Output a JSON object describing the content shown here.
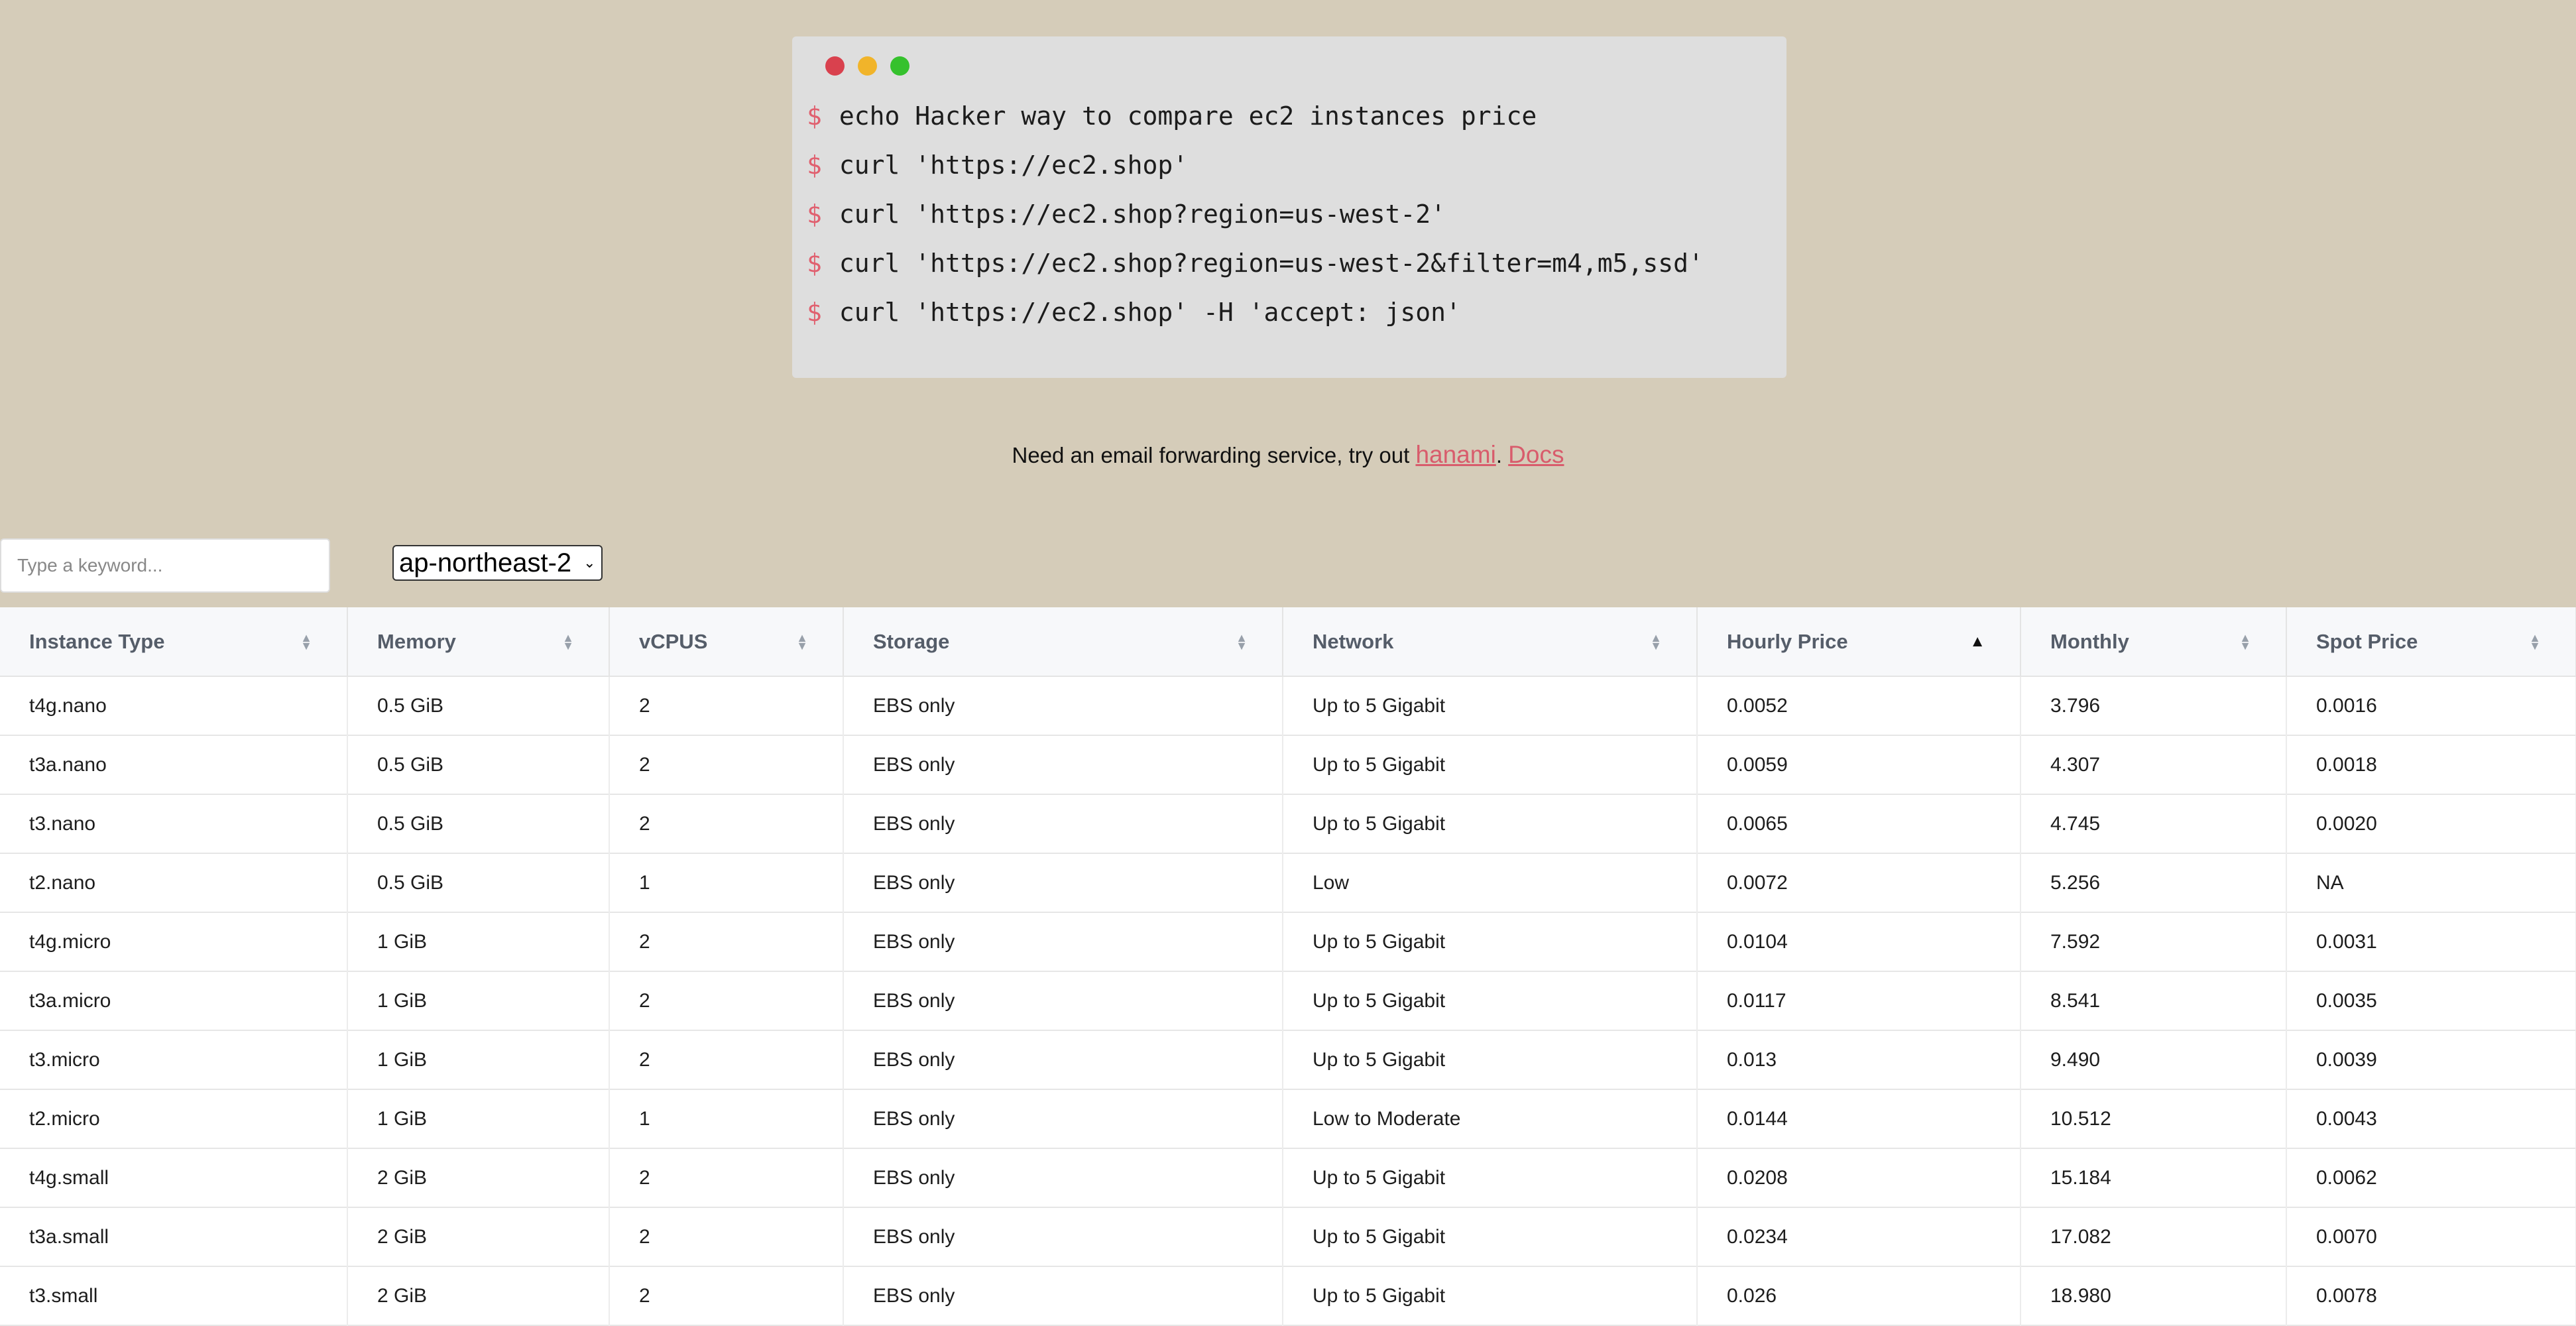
{
  "terminal": {
    "dot_colors": [
      "#d9414e",
      "#f1b42a",
      "#35c12d"
    ],
    "prompt": "$",
    "commands": [
      "echo Hacker way to compare ec2 instances price",
      "curl 'https://ec2.shop'",
      "curl 'https://ec2.shop?region=us-west-2'",
      "curl 'https://ec2.shop?region=us-west-2&filter=m4,m5,ssd'",
      "curl 'https://ec2.shop' -H 'accept: json'"
    ]
  },
  "promo": {
    "text": "Need an email forwarding service, try out ",
    "link1": "hanami",
    "separator": ". ",
    "link2": "Docs"
  },
  "search": {
    "placeholder": "Type a keyword..."
  },
  "region": {
    "selected": "ap-northeast-2"
  },
  "table": {
    "columns": [
      "Instance Type",
      "Memory",
      "vCPUS",
      "Storage",
      "Network",
      "Hourly Price",
      "Monthly",
      "Spot Price"
    ],
    "sorted_column": "Hourly Price",
    "rows": [
      [
        "t4g.nano",
        "0.5 GiB",
        "2",
        "EBS only",
        "Up to 5 Gigabit",
        "0.0052",
        "3.796",
        "0.0016"
      ],
      [
        "t3a.nano",
        "0.5 GiB",
        "2",
        "EBS only",
        "Up to 5 Gigabit",
        "0.0059",
        "4.307",
        "0.0018"
      ],
      [
        "t3.nano",
        "0.5 GiB",
        "2",
        "EBS only",
        "Up to 5 Gigabit",
        "0.0065",
        "4.745",
        "0.0020"
      ],
      [
        "t2.nano",
        "0.5 GiB",
        "1",
        "EBS only",
        "Low",
        "0.0072",
        "5.256",
        "NA"
      ],
      [
        "t4g.micro",
        "1 GiB",
        "2",
        "EBS only",
        "Up to 5 Gigabit",
        "0.0104",
        "7.592",
        "0.0031"
      ],
      [
        "t3a.micro",
        "1 GiB",
        "2",
        "EBS only",
        "Up to 5 Gigabit",
        "0.0117",
        "8.541",
        "0.0035"
      ],
      [
        "t3.micro",
        "1 GiB",
        "2",
        "EBS only",
        "Up to 5 Gigabit",
        "0.013",
        "9.490",
        "0.0039"
      ],
      [
        "t2.micro",
        "1 GiB",
        "1",
        "EBS only",
        "Low to Moderate",
        "0.0144",
        "10.512",
        "0.0043"
      ],
      [
        "t4g.small",
        "2 GiB",
        "2",
        "EBS only",
        "Up to 5 Gigabit",
        "0.0208",
        "15.184",
        "0.0062"
      ],
      [
        "t3a.small",
        "2 GiB",
        "2",
        "EBS only",
        "Up to 5 Gigabit",
        "0.0234",
        "17.082",
        "0.0070"
      ],
      [
        "t3.small",
        "2 GiB",
        "2",
        "EBS only",
        "Up to 5 Gigabit",
        "0.026",
        "18.980",
        "0.0078"
      ]
    ]
  }
}
